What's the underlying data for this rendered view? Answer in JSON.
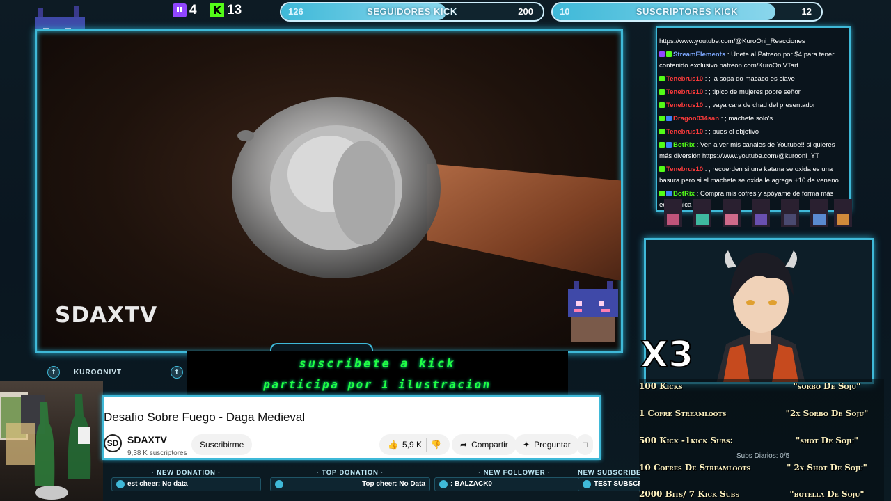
{
  "topbar": {
    "twitch_count": "4",
    "kick_count": "13",
    "followers_goal": {
      "current": "126",
      "label": "SEGUIDORES KICK",
      "target": "200"
    },
    "subs_goal": {
      "current": "10",
      "label": "SUSCRIPTORES KICK",
      "target": "12"
    }
  },
  "video": {
    "watermark": "SDAXTV"
  },
  "chat": {
    "messages": [
      {
        "user": "",
        "text": "https://www.youtube.com/@KuroOni_Reacciones",
        "color": "#ff4d4d"
      },
      {
        "user": "StreamElements",
        "text": " : Únete al Patreon por $4 para tener contenido exclusivo patreon.com/KuroOniVTart",
        "color": "#7da8ff"
      },
      {
        "user": "Tenebrus10",
        "text": " : ; la sopa do macaco es clave",
        "color": "#ff3b3b"
      },
      {
        "user": "Tenebrus10",
        "text": " : ; tipico de mujeres pobre señor",
        "color": "#ff3b3b"
      },
      {
        "user": "Tenebrus10",
        "text": " : ; vaya cara de chad del presentador",
        "color": "#ff3b3b"
      },
      {
        "user": "Dragon034san",
        "text": " : ; machete solo's",
        "color": "#ff3b3b"
      },
      {
        "user": "Tenebrus10",
        "text": " : ; pues el objetivo",
        "color": "#ff3b3b"
      },
      {
        "user": "BotRix",
        "text": " : Ven a ver mis canales de Youtube!! si quieres más diversión https://www.youtube.com/@kurooni_YT",
        "color": "#53fc18"
      },
      {
        "user": "Tenebrus10",
        "text": " : ; recuerden si una katana se oxida es una basura pero si el machete se oxida le agrega +10 de veneno",
        "color": "#ff3b3b"
      },
      {
        "user": "BotRix",
        "text": " : Compra mis cofres y apóyame de forma más económica",
        "color": "#53fc18"
      }
    ]
  },
  "vtuber": {
    "multiplier": "X3"
  },
  "rules": [
    {
      "key": "100 Kicks",
      "value": "\"sorbo De Soju\""
    },
    {
      "key": "1 Cofre Streamloots",
      "value": "\"2x Sorbo De Soju\""
    },
    {
      "key": "500 Kick -1kick Subs:",
      "value": "\"shot De Soju\""
    },
    {
      "key": "10 Cofres De Streamloots",
      "value": "\" 2x Shot De Soju\""
    },
    {
      "key": "2000 Bits/ 7 Kick Subs",
      "value": "\"botella De Soju\""
    }
  ],
  "subs_daily": "Subs Diarios: 0/5",
  "banner": {
    "line1": "suscribete a kick",
    "line2": "participa por 1 ilustracion"
  },
  "social": {
    "facebook_icon": "facebook-icon",
    "twitter_icon": "twitter-icon",
    "handle": "KUROONIVT"
  },
  "youtube": {
    "title": "Desafio Sobre Fuego - Daga Medieval",
    "avatar_text": "SD",
    "channel": "SDAXTV",
    "subs": "9,38 K suscriptores",
    "subscribe": "Suscribirme",
    "likes": "5,9 K",
    "share": "Compartir",
    "ask": "Preguntar"
  },
  "alerts": [
    {
      "title": "· NEW DONATION ·",
      "body": "est cheer: No data"
    },
    {
      "title": "· TOP DONATION ·",
      "body": "Top cheer: No Data"
    },
    {
      "title": "· NEW FOLLOWER ·",
      "body": ": BALZACK0"
    },
    {
      "title": "NEW SUBSCRIBER",
      "body": "TEST SUBSCRIBER: GENERALMORA"
    }
  ],
  "colors": {
    "accent": "#3fb9d8",
    "kick_green": "#53fc18",
    "twitch_purple": "#9146ff",
    "banner_green": "#22ff44"
  }
}
